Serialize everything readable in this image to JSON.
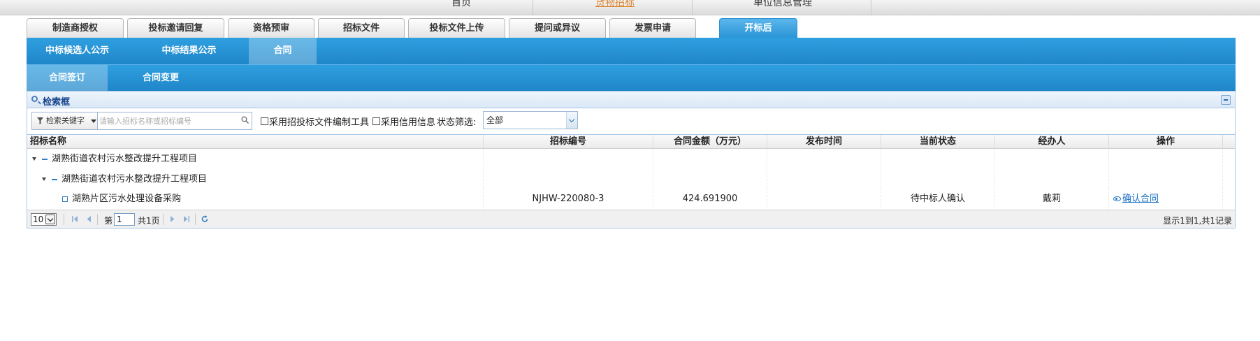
{
  "top_nav": {
    "items": [
      {
        "label": "首页",
        "active": false
      },
      {
        "label": "货物招标",
        "active": true
      },
      {
        "label": "单位信息管理",
        "active": false
      }
    ]
  },
  "tabs": [
    {
      "label": "制造商授权",
      "active": false
    },
    {
      "label": "投标邀请回复",
      "active": false
    },
    {
      "label": "资格预审",
      "active": false
    },
    {
      "label": "招标文件",
      "active": false
    },
    {
      "label": "投标文件上传",
      "active": false
    },
    {
      "label": "提问或异议",
      "active": false
    },
    {
      "label": "发票申请",
      "active": false
    },
    {
      "label": "开标后",
      "active": true
    }
  ],
  "subtabs_level1": [
    {
      "label": "中标候选人公示",
      "active": false
    },
    {
      "label": "中标结果公示",
      "active": false
    },
    {
      "label": "合同",
      "active": true
    }
  ],
  "subtabs_level2": [
    {
      "label": "合同签订",
      "active": true
    },
    {
      "label": "合同变更",
      "active": false
    }
  ],
  "search": {
    "panel_title": "检索框",
    "keyword_select": "检索关键字",
    "keyword_placeholder": "请输入招标名称或招标编号",
    "checkbox_tool": "采用招投标文件编制工具",
    "checkbox_credit": "采用信用信息",
    "status_label": "状态筛选:",
    "status_value": "全部"
  },
  "table": {
    "columns": [
      "招标名称",
      "招标编号",
      "合同金额（万元）",
      "发布时间",
      "当前状态",
      "经办人",
      "操作"
    ],
    "rows": [
      {
        "level": 0,
        "name": "湖熟街道农村污水整改提升工程项目",
        "code": "",
        "amount": "",
        "publish": "",
        "status": "",
        "handler": "",
        "action": ""
      },
      {
        "level": 1,
        "name": "湖熟街道农村污水整改提升工程项目",
        "code": "",
        "amount": "",
        "publish": "",
        "status": "",
        "handler": "",
        "action": ""
      },
      {
        "level": 2,
        "name": "湖熟片区污水处理设备采购",
        "code": "NJHW-220080-3",
        "amount": "424.691900",
        "publish": "",
        "status": "待中标人确认",
        "handler": "戴莉",
        "action": "确认合同"
      }
    ]
  },
  "pager": {
    "page_size": "10",
    "page_prefix": "第",
    "current_page": "1",
    "total_pages": "共1页",
    "record_info": "显示1到1,共1记录"
  }
}
